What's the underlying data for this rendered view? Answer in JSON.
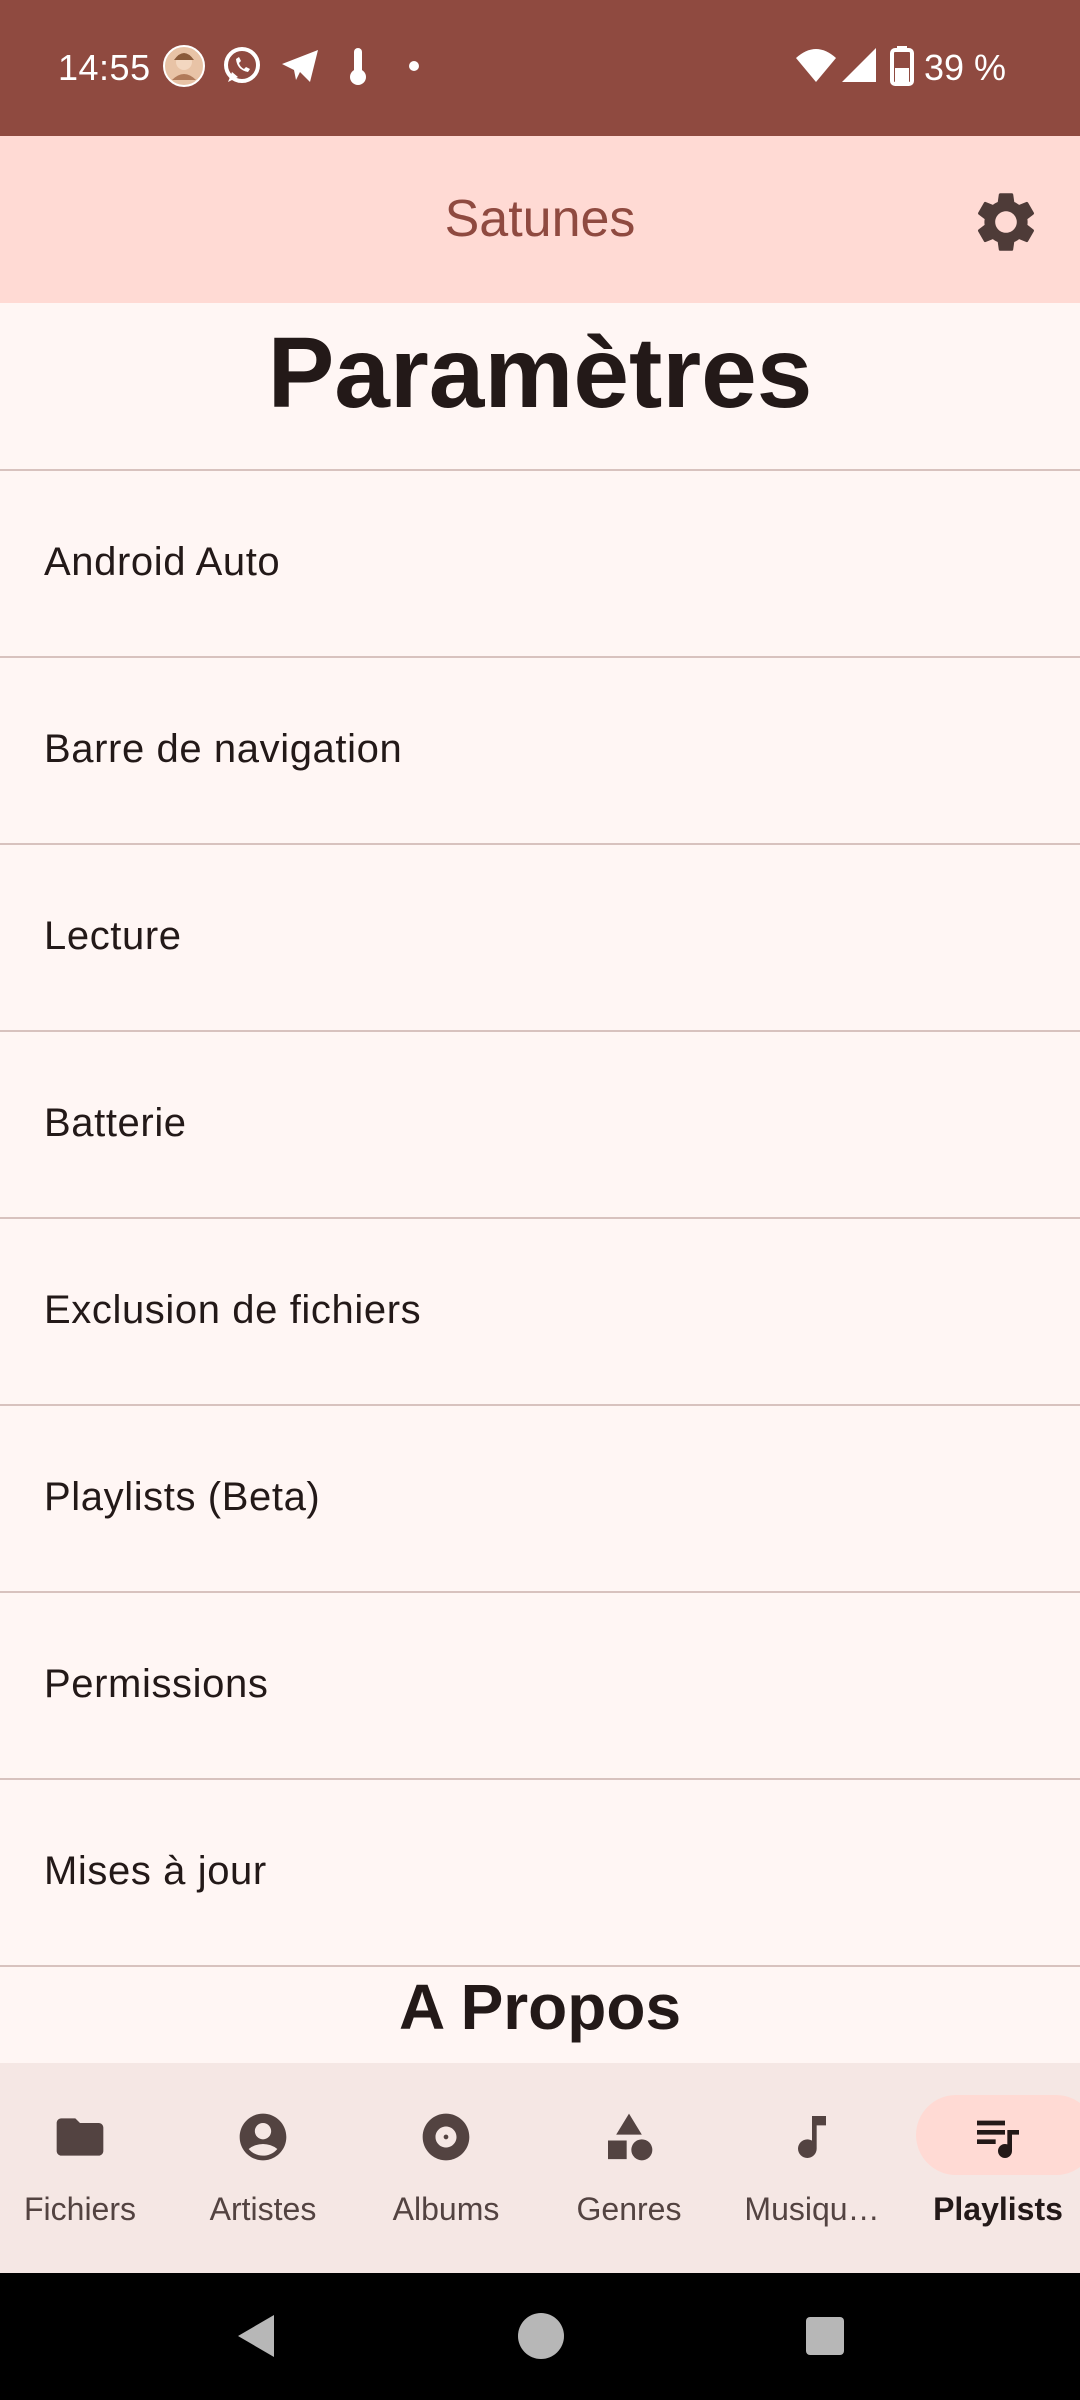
{
  "status_bar": {
    "time": "14:55",
    "battery_text": "39 %",
    "icons": [
      "avatar-icon",
      "whatsapp-icon",
      "telegram-icon",
      "thermometer-icon",
      "dot-icon",
      "wifi-icon",
      "signal-icon",
      "battery-icon"
    ]
  },
  "app_bar": {
    "title": "Satunes",
    "settings_icon": "gear-icon"
  },
  "page": {
    "title": "Paramètres",
    "items": [
      {
        "label": "Android Auto"
      },
      {
        "label": "Barre de navigation"
      },
      {
        "label": "Lecture"
      },
      {
        "label": "Batterie"
      },
      {
        "label": "Exclusion de fichiers"
      },
      {
        "label": "Playlists (Beta)"
      },
      {
        "label": "Permissions"
      },
      {
        "label": "Mises à jour"
      }
    ],
    "section_title": "A Propos"
  },
  "bottom_nav": {
    "items": [
      {
        "label": "Fichiers",
        "icon": "folder-icon",
        "active": false
      },
      {
        "label": "Artistes",
        "icon": "person-icon",
        "active": false
      },
      {
        "label": "Albums",
        "icon": "disc-icon",
        "active": false
      },
      {
        "label": "Genres",
        "icon": "shapes-icon",
        "active": false
      },
      {
        "label": "Musiqu…",
        "icon": "music-note-icon",
        "active": false
      },
      {
        "label": "Playlists",
        "icon": "playlist-icon",
        "active": true
      }
    ]
  },
  "colors": {
    "status_bar": "#8f4a40",
    "app_bar": "#ffdad4",
    "background": "#fff6f4",
    "nav_bar": "#f5e7e4",
    "active_pill": "#ffdad4",
    "text": "#231918"
  }
}
